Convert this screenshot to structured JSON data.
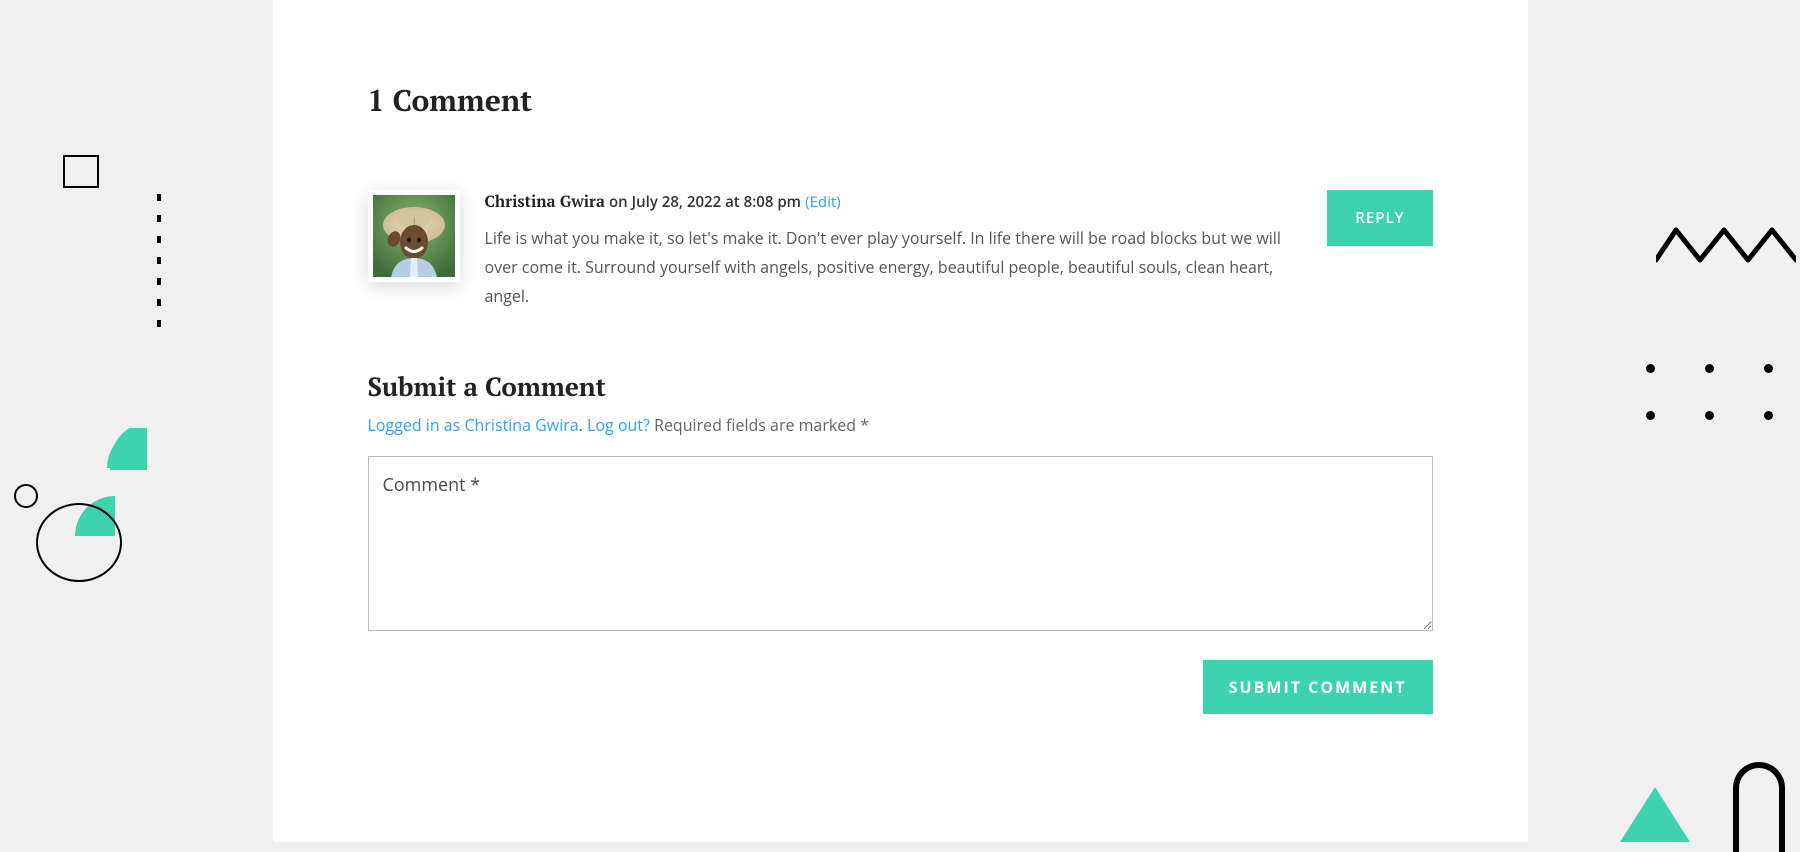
{
  "comments_section": {
    "title": "1 Comment",
    "comment": {
      "author": "Christina Gwira",
      "date_prefix": "on ",
      "date": "July 28, 2022 at 8:08 pm",
      "edit_label": "(Edit)",
      "text": "Life is what you make it, so let's make it. Don't ever play yourself. In life there will be road blocks but we will over come it. Surround yourself with angels, positive energy, beautiful people, beautiful souls, clean heart, angel.",
      "reply_label": "REPLY"
    }
  },
  "form": {
    "title": "Submit a Comment",
    "logged_in_prefix": "Logged in as ",
    "logged_in_user": "Christina Gwira",
    "logged_in_separator": ". ",
    "logout_label": "Log out?",
    "required_note": " Required fields are marked *",
    "textarea_placeholder": "Comment *",
    "submit_label": "SUBMIT COMMENT"
  }
}
